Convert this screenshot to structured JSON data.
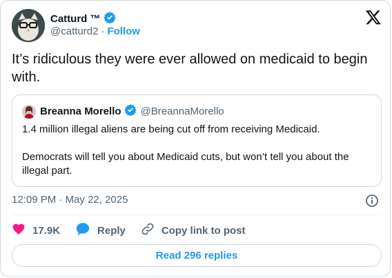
{
  "author": {
    "name": "Catturd ™",
    "handle": "@catturd2",
    "separator": "·",
    "follow_label": "Follow",
    "verified": true
  },
  "tweet": {
    "text": "It’s ridiculous they were ever allowed on medicaid to begin with."
  },
  "quote": {
    "name": "Breanna Morello",
    "handle": "@BreannaMorello",
    "verified": true,
    "paragraphs": [
      "1.4 million illegal aliens are being cut off from receiving Medicaid.",
      "Democrats will tell you about Medicaid cuts, but won’t tell you about the illegal part."
    ]
  },
  "meta": {
    "time": "12:09 PM",
    "separator": "·",
    "date": "May 22, 2025"
  },
  "actions": {
    "like_count": "17.9K",
    "reply_label": "Reply",
    "copy_label": "Copy link to post"
  },
  "read_replies_label": "Read 296 replies",
  "icons": {
    "platform": "x-logo-icon",
    "verified": "verified-badge-icon",
    "info": "info-icon",
    "like": "heart-icon",
    "reply": "reply-bubble-icon",
    "copy": "link-icon"
  },
  "colors": {
    "accent": "#1d9bf0",
    "like": "#f91880",
    "text": "#0f1419",
    "muted": "#536471",
    "border": "#cfd9de"
  }
}
